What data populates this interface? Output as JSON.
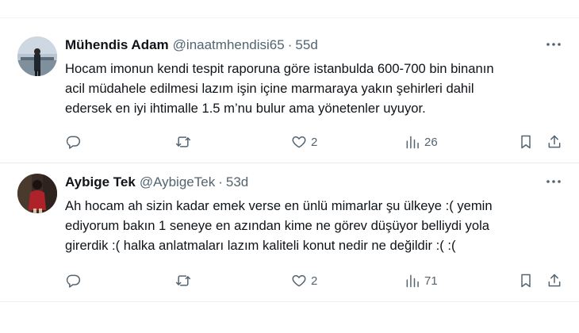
{
  "tweets": [
    {
      "name": "Mühendis Adam",
      "handle": "@inaatmhendisi65",
      "separator": "·",
      "time": "55d",
      "lines": [
        "Hocam imonun kendi tespit raporuna göre istanbulda 600-700 bin binanın",
        "acil müdahele edilmesi lazım işin içine marmaraya yakın şehirleri dahil",
        "edersek en iyi ihtimalle 1.5 m’nu bulur ama yönetenler uyuyor."
      ],
      "replies": "",
      "retweets": "",
      "likes": "2",
      "views": "26"
    },
    {
      "name": "Aybige Tek",
      "handle": "@AybigeTek",
      "separator": "·",
      "time": "53d",
      "lines": [
        "Ah hocam ah sizin kadar emek verse en ünlü mimarlar şu ülkeye :( yemin",
        "ediyorum bakın 1 seneye en azından kime ne görev düşüyor belliydi yola",
        "girerdik :( halka anlatmaları lazım kaliteli konut nedir ne değildir :( :("
      ],
      "replies": "",
      "retweets": "",
      "likes": "2",
      "views": "71"
    }
  ],
  "icons": {
    "more": "more-horizontal-icon",
    "reply": "reply-icon",
    "retweet": "retweet-icon",
    "like": "heart-icon",
    "views": "views-bar-chart-icon",
    "bookmark": "bookmark-icon",
    "share": "share-icon"
  },
  "colors": {
    "text": "#0f1419",
    "secondary": "#536471",
    "divider": "#e6ecf0"
  }
}
